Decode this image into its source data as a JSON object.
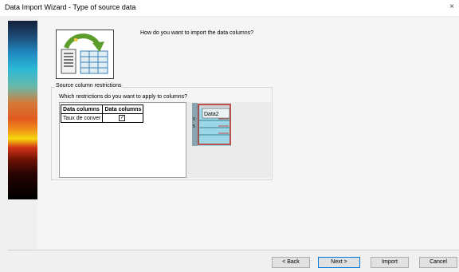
{
  "window": {
    "title": "Data Import Wizard - Type of source data",
    "close_glyph": "×"
  },
  "header": {
    "question": "How do you want to import the data columns?"
  },
  "restrictions": {
    "group_label": "Source column restrictions",
    "instructions": "Which restrictions do you want to apply to columns?",
    "columns": [
      "Data columns",
      "Data columns"
    ],
    "rows": [
      {
        "name": "Taux de conver",
        "checked": true
      }
    ],
    "check_glyph": "✓"
  },
  "preview": {
    "column_header": "Data2",
    "row_marker_1": "0",
    "row_marker_2": "5",
    "accent_color": "#c0504d",
    "fill_color": "#9bd7e6"
  },
  "buttons": {
    "back": "< Back",
    "next": "Next >",
    "import": "Import",
    "cancel": "Cancel"
  }
}
